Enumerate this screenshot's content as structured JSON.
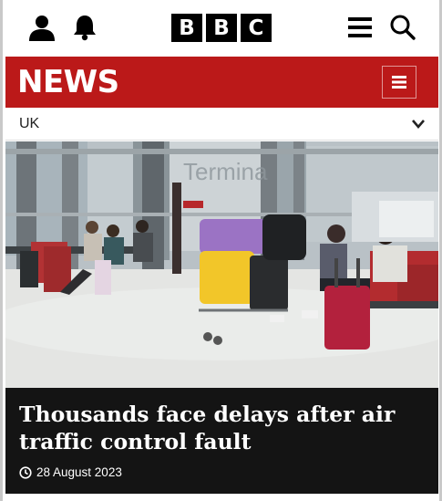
{
  "header": {
    "logo_letters": [
      "B",
      "B",
      "C"
    ],
    "icons": {
      "account": "user-icon",
      "notifications": "bell-icon",
      "menu": "hamburger-menu-icon",
      "search": "search-icon"
    }
  },
  "news_bar": {
    "title": "NEWS",
    "menu_icon": "hamburger-menu-icon",
    "background_color": "#bb1919"
  },
  "section": {
    "label": "UK",
    "chevron_icon": "chevron-down-icon"
  },
  "article": {
    "headline": "Thousands face delays after air traffic control fault",
    "date": "28 August 2023",
    "date_icon": "clock-icon",
    "image_sign_text": "Termina"
  }
}
